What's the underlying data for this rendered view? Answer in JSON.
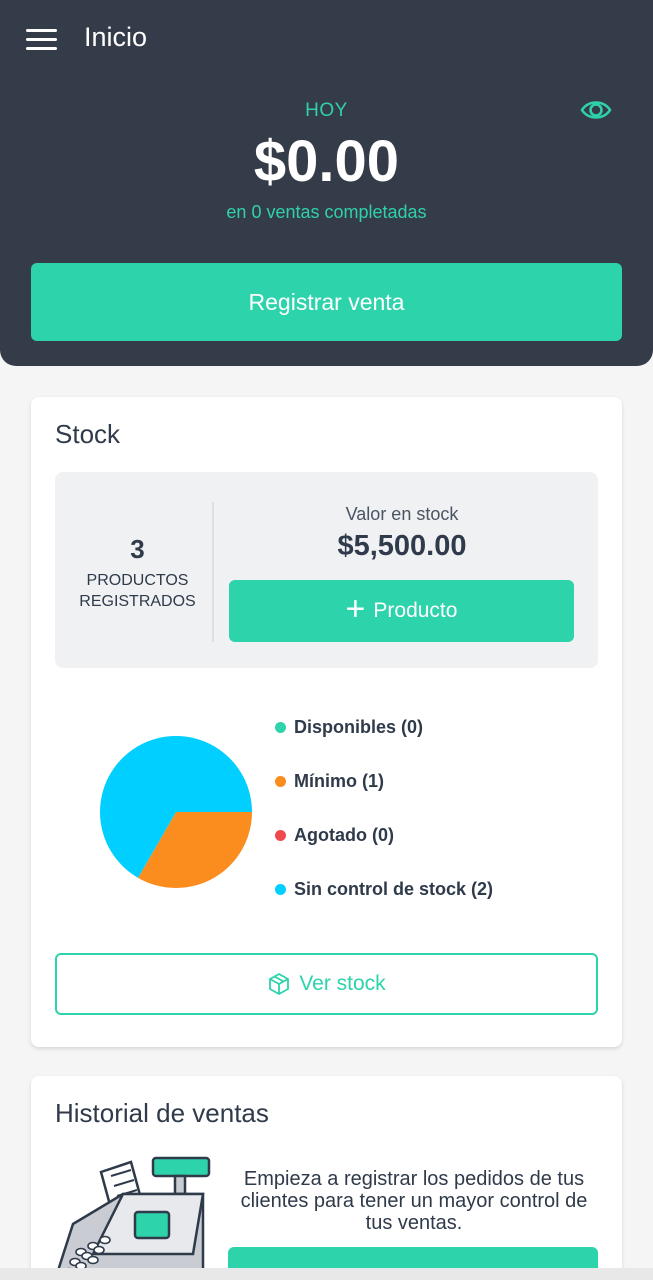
{
  "header": {
    "title": "Inicio",
    "period_label": "HOY",
    "total_amount": "$0.00",
    "sales_subtitle": "en 0 ventas completadas",
    "register_button_label": "Registrar venta"
  },
  "stock": {
    "title": "Stock",
    "product_count": "3",
    "product_count_label": "PRODUCTOS REGISTRADOS",
    "stock_value_label": "Valor en stock",
    "stock_value": "$5,500.00",
    "add_product_label": "Producto",
    "view_stock_label": "Ver stock"
  },
  "chart_data": {
    "type": "pie",
    "slices": [
      {
        "label": "Disponibles (0)",
        "value": 0,
        "color": "#2dd3ab"
      },
      {
        "label": "Mínimo (1)",
        "value": 1,
        "color": "#fb8c1e"
      },
      {
        "label": "Agotado (0)",
        "value": 0,
        "color": "#f0484f"
      },
      {
        "label": "Sin control de stock (2)",
        "value": 2,
        "color": "#00cfff"
      }
    ],
    "legend_position": "right"
  },
  "history": {
    "title": "Historial de ventas",
    "empty_text": "Empieza a registrar los pedidos de tus clientes para tener un mayor control de tus ventas."
  },
  "colors": {
    "header_bg": "#353c49",
    "accent": "#2dd3ab",
    "text_dark": "#2f3a4a"
  },
  "icons": {
    "menu": "hamburger-menu-icon",
    "eye": "eye-icon",
    "plus": "plus-icon",
    "box": "box-icon",
    "register": "cash-register-illustration"
  }
}
